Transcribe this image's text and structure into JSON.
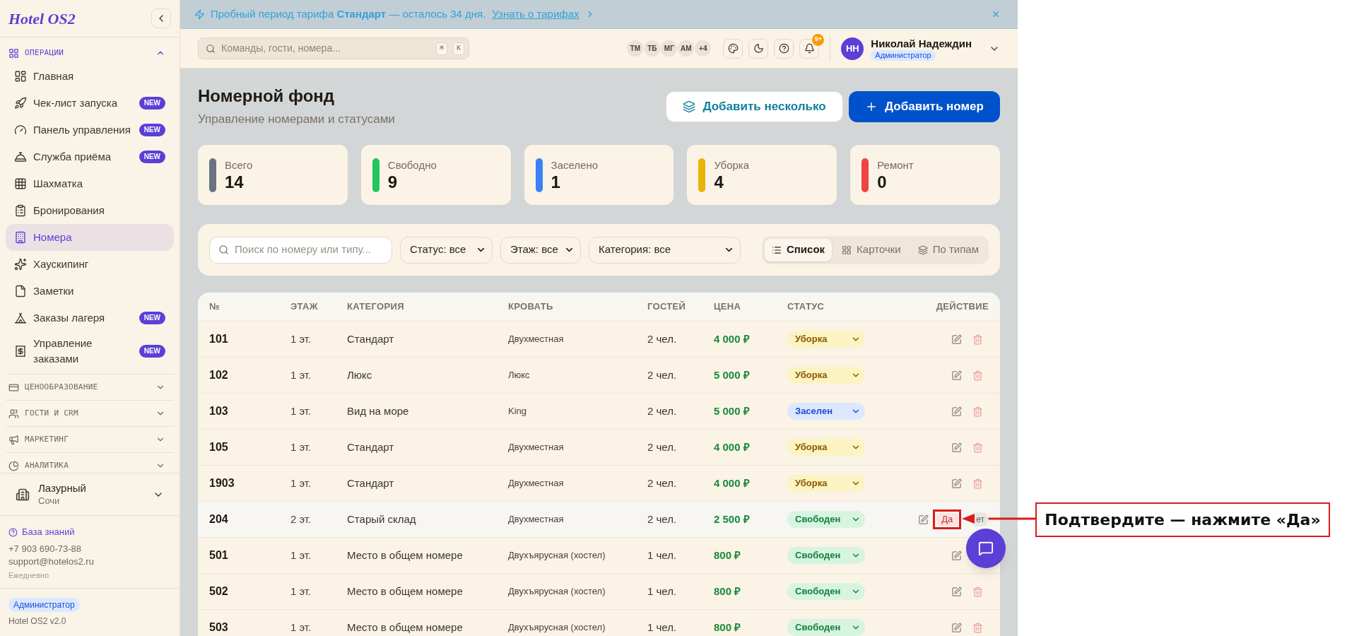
{
  "banner": {
    "text": "Пробный период тарифа **Стандарт** — осталось 34 дня.",
    "link": "Узнать о тарифах"
  },
  "sidebar": {
    "logo": "Hotel OS2",
    "sections": [
      {
        "label": "ОПЕРАЦИИ",
        "expanded": true,
        "items": [
          {
            "label": "Главная",
            "selected": false
          },
          {
            "label": "Чек-лист запуска",
            "badge": "NEW",
            "selected": false
          },
          {
            "label": "Панель управления",
            "badge": "NEW",
            "selected": false
          },
          {
            "label": "Служба приёма",
            "badge": "NEW",
            "selected": false
          },
          {
            "label": "Шахматка",
            "selected": false
          },
          {
            "label": "Бронирования",
            "selected": false
          },
          {
            "label": "Номера",
            "selected": true
          },
          {
            "label": "Хаускипинг",
            "selected": false
          },
          {
            "label": "Заметки",
            "selected": false
          },
          {
            "label": "Заказы лагеря",
            "badge": "NEW",
            "selected": false
          },
          {
            "label": "Управление заказами",
            "badge": "NEW",
            "selected": false
          }
        ]
      },
      {
        "label": "ЦЕНООБРАЗОВАНИЕ",
        "expanded": false
      },
      {
        "label": "ГОСТИ И CRM",
        "expanded": false
      },
      {
        "label": "МАРКЕТИНГ",
        "expanded": false
      },
      {
        "label": "АНАЛИТИКА",
        "expanded": false
      }
    ],
    "hotel": {
      "name": "Лазурный",
      "city": "Сочи"
    },
    "support": {
      "link": "База знаний",
      "phone": "+7 903 690-73-88",
      "email": "support@hotelos2.ru",
      "hours": "Ежедневно"
    },
    "role": "Администратор",
    "version": "Hotel OS2 v2.0"
  },
  "header": {
    "search": {
      "placeholder": "Команды, гости, номера...",
      "keys": [
        "⌘",
        "K"
      ]
    },
    "avatars": [
      "ТМ",
      "ТБ",
      "МГ",
      "АМ",
      "+4"
    ],
    "notifications_badge": "9+",
    "user": {
      "initials": "НН",
      "name": "Николай Надеждин",
      "role": "Администратор"
    }
  },
  "page": {
    "title": "Номерной фонд",
    "subtitle": "Управление номерами и статусами",
    "buttons": [
      {
        "label": "Добавить несколько",
        "kind": "secondary"
      },
      {
        "label": "Добавить номер",
        "kind": "primary"
      }
    ]
  },
  "stats": [
    {
      "label": "Всего",
      "value": "14",
      "color": "#6b7280"
    },
    {
      "label": "Свободно",
      "value": "9",
      "color": "#22c55e"
    },
    {
      "label": "Заселено",
      "value": "1",
      "color": "#3b82f6"
    },
    {
      "label": "Уборка",
      "value": "4",
      "color": "#eab308"
    },
    {
      "label": "Ремонт",
      "value": "0",
      "color": "#ef4444"
    }
  ],
  "filters": {
    "search": {
      "placeholder": "Поиск по номеру или типу..."
    },
    "selects": [
      "Статус: все",
      "Этаж: все",
      "Категория: все"
    ],
    "views": [
      {
        "label": "Список",
        "selected": true
      },
      {
        "label": "Карточки",
        "selected": false
      },
      {
        "label": "По типам",
        "selected": false
      }
    ]
  },
  "table": {
    "columns": [
      "№",
      "ЭТАЖ",
      "КАТЕГОРИЯ",
      "КРОВАТЬ",
      "ГОСТЕЙ",
      "ЦЕНА",
      "СТАТУС",
      "ДЕЙСТВИЕ"
    ],
    "rows": [
      {
        "number": "101",
        "floor": "1 эт.",
        "category": "Стандарт",
        "bed": "Двухместная",
        "guests": "2 чел.",
        "price": "4 000 ₽",
        "status": {
          "label": "Уборка",
          "kind": "cleaning"
        },
        "highlighted": false
      },
      {
        "number": "102",
        "floor": "1 эт.",
        "category": "Люкс",
        "bed": "Люкс",
        "guests": "2 чел.",
        "price": "5 000 ₽",
        "status": {
          "label": "Уборка",
          "kind": "cleaning"
        },
        "highlighted": false
      },
      {
        "number": "103",
        "floor": "1 эт.",
        "category": "Вид на море",
        "bed": "King",
        "guests": "2 чел.",
        "price": "5 000 ₽",
        "status": {
          "label": "Заселен",
          "kind": "occupied"
        },
        "highlighted": false
      },
      {
        "number": "105",
        "floor": "1 эт.",
        "category": "Стандарт",
        "bed": "Двухместная",
        "guests": "2 чел.",
        "price": "4 000 ₽",
        "status": {
          "label": "Уборка",
          "kind": "cleaning"
        },
        "highlighted": false
      },
      {
        "number": "1903",
        "floor": "1 эт.",
        "category": "Стандарт",
        "bed": "Двухместная",
        "guests": "2 чел.",
        "price": "4 000 ₽",
        "status": {
          "label": "Уборка",
          "kind": "cleaning"
        },
        "highlighted": false
      },
      {
        "number": "204",
        "floor": "2 эт.",
        "category": "Старый склад",
        "bed": "Двухместная",
        "guests": "2 чел.",
        "price": "2 500 ₽",
        "status": {
          "label": "Свободен",
          "kind": "free"
        },
        "highlighted": true,
        "confirm": {
          "yes": "Да",
          "no": "ет"
        }
      },
      {
        "number": "501",
        "floor": "1 эт.",
        "category": "Место в общем номере",
        "bed": "Двухъярусная (хостел)",
        "guests": "1 чел.",
        "price": "800 ₽",
        "status": {
          "label": "Свободен",
          "kind": "free"
        },
        "highlighted": false
      },
      {
        "number": "502",
        "floor": "1 эт.",
        "category": "Место в общем номере",
        "bed": "Двухъярусная (хостел)",
        "guests": "1 чел.",
        "price": "800 ₽",
        "status": {
          "label": "Свободен",
          "kind": "free"
        },
        "highlighted": false
      },
      {
        "number": "503",
        "floor": "1 эт.",
        "category": "Место в общем номере",
        "bed": "Двухъярусная (хостел)",
        "guests": "1 чел.",
        "price": "800 ₽",
        "status": {
          "label": "Свободен",
          "kind": "free"
        },
        "highlighted": false
      }
    ]
  },
  "annotation": {
    "text": "Подтвердите — нажмите «Да»"
  }
}
